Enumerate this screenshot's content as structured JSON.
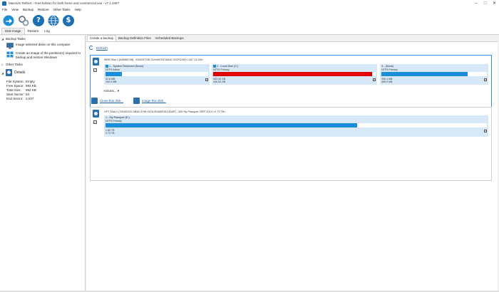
{
  "window": {
    "title": "Macrium Reflect - Free Edition for both home and commercial use - v7.1.2497",
    "minimize": "─",
    "maximize": "□",
    "close": "✕"
  },
  "menu": [
    "File",
    "View",
    "Backup",
    "Restore",
    "Other Tasks",
    "Help"
  ],
  "toolbar": [
    {
      "icon": "backup-icon",
      "color": "#1a8ed8"
    },
    {
      "icon": "gear-icon",
      "color": "#6b7a8a"
    },
    {
      "icon": "help-icon",
      "color": "#1a6fb5",
      "glyph": "?"
    },
    {
      "icon": "globe-icon",
      "color": "#1a6fb5"
    },
    {
      "icon": "dollar-icon",
      "color": "#1a6fb5",
      "glyph": "$"
    }
  ],
  "view_tabs": [
    "Disk Image",
    "Restore",
    "Log"
  ],
  "left": {
    "backup_tasks": "Backup Tasks",
    "task1": "Image selected disks on this computer",
    "task2": "Create an image of the partition(s) required to backup and restore Windows",
    "other_tasks": "Other Tasks",
    "details": "Details",
    "detail_rows": [
      {
        "k": "File System:",
        "v": "Empty"
      },
      {
        "k": "Free Space:",
        "v": "992 KB"
      },
      {
        "k": "Total Size:",
        "v": "992 KB"
      },
      {
        "k": "Start Sector:",
        "v": "63"
      },
      {
        "k": "End Sector:",
        "v": "2,047"
      }
    ]
  },
  "main": {
    "tabs": [
      "Create a backup",
      "Backup Definition Files",
      "Scheduled Backups"
    ],
    "refresh": "Refresh",
    "actions": "Actions...",
    "clone": "Clone this disk...",
    "image": "Image this disk..."
  },
  "disk1": {
    "title": "MBR Disk 1 [A6896C08] - KINGSTON SUV400S37480G 0C0FD4D0  <447.13 GB>",
    "partitions": [
      {
        "name": "1 - System Reserved (None)",
        "fs": "NTFS Active",
        "used": "32.8 MB",
        "total": "100.0 MB",
        "fill": 0.16,
        "color": "#1a8ed8"
      },
      {
        "name": "2 - Local Disk (C:)",
        "fs": "NTFS Primary",
        "used": "403.44 GB",
        "total": "446.53 GB",
        "fill": 0.98,
        "color": "#e00000"
      },
      {
        "name": "3 - (None)",
        "fs": "NTFS Primary",
        "used": "396.4 MB",
        "total": "499.0 MB",
        "fill": 0.82,
        "color": "#1a8ed8"
      }
    ]
  },
  "disk2": {
    "title": "GPT Disk 2 [7D04E220-0B48-4798-9478-0EA8EDDC4A0E] - WD        My Passport 25FF 1014  <2.73 TB>",
    "partitions": [
      {
        "name": "1 - My Passport (E:)",
        "fs": "NTFS Primary",
        "used": "1.80 TB",
        "total": "2.73 TB",
        "fill": 0.66,
        "color": "#1a8ed8"
      }
    ]
  }
}
